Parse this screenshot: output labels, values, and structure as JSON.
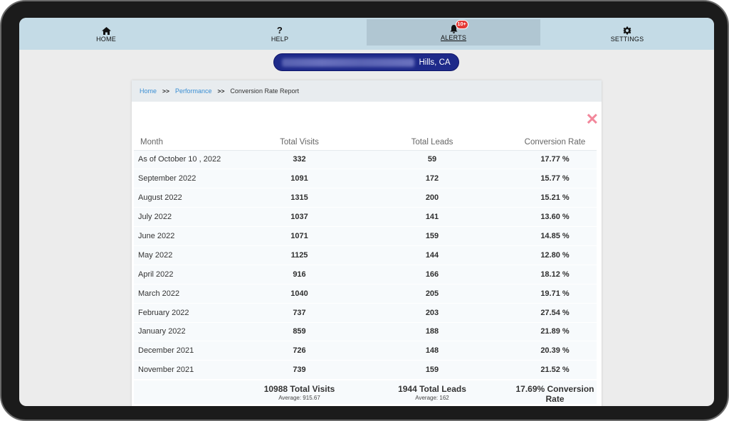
{
  "nav": {
    "items": [
      {
        "label": "HOME",
        "icon": "home-icon"
      },
      {
        "label": "HELP",
        "icon": "help-icon",
        "glyph": "?"
      },
      {
        "label": "ALERTS",
        "icon": "bell-icon",
        "badge": "10+"
      },
      {
        "label": "SETTINGS",
        "icon": "gear-icon"
      }
    ],
    "active": "ALERTS"
  },
  "location": {
    "visible_suffix": "Hills, CA"
  },
  "breadcrumb": {
    "home": "Home",
    "sep": ">>",
    "performance": "Performance",
    "current": "Conversion Rate Report"
  },
  "close_glyph": "✕",
  "report": {
    "headers": [
      "Month",
      "Total Visits",
      "Total Leads",
      "Conversion Rate"
    ],
    "rows": [
      {
        "month": "As of October 10 , 2022",
        "visits": "332",
        "leads": "59",
        "rate": "17.77 %"
      },
      {
        "month": "September 2022",
        "visits": "1091",
        "leads": "172",
        "rate": "15.77 %"
      },
      {
        "month": "August 2022",
        "visits": "1315",
        "leads": "200",
        "rate": "15.21 %"
      },
      {
        "month": "July 2022",
        "visits": "1037",
        "leads": "141",
        "rate": "13.60 %"
      },
      {
        "month": "June 2022",
        "visits": "1071",
        "leads": "159",
        "rate": "14.85 %"
      },
      {
        "month": "May 2022",
        "visits": "1125",
        "leads": "144",
        "rate": "12.80 %"
      },
      {
        "month": "April 2022",
        "visits": "916",
        "leads": "166",
        "rate": "18.12 %"
      },
      {
        "month": "March 2022",
        "visits": "1040",
        "leads": "205",
        "rate": "19.71 %"
      },
      {
        "month": "February 2022",
        "visits": "737",
        "leads": "203",
        "rate": "27.54 %"
      },
      {
        "month": "January 2022",
        "visits": "859",
        "leads": "188",
        "rate": "21.89 %"
      },
      {
        "month": "December 2021",
        "visits": "726",
        "leads": "148",
        "rate": "20.39 %"
      },
      {
        "month": "November 2021",
        "visits": "739",
        "leads": "159",
        "rate": "21.52 %"
      }
    ],
    "totals": {
      "visits": "10988 Total Visits",
      "visits_avg": "Average: 915.67",
      "leads": "1944 Total Leads",
      "leads_avg": "Average: 162",
      "rate_line1": "17.69% Conversion",
      "rate_line2": "Rate"
    }
  }
}
